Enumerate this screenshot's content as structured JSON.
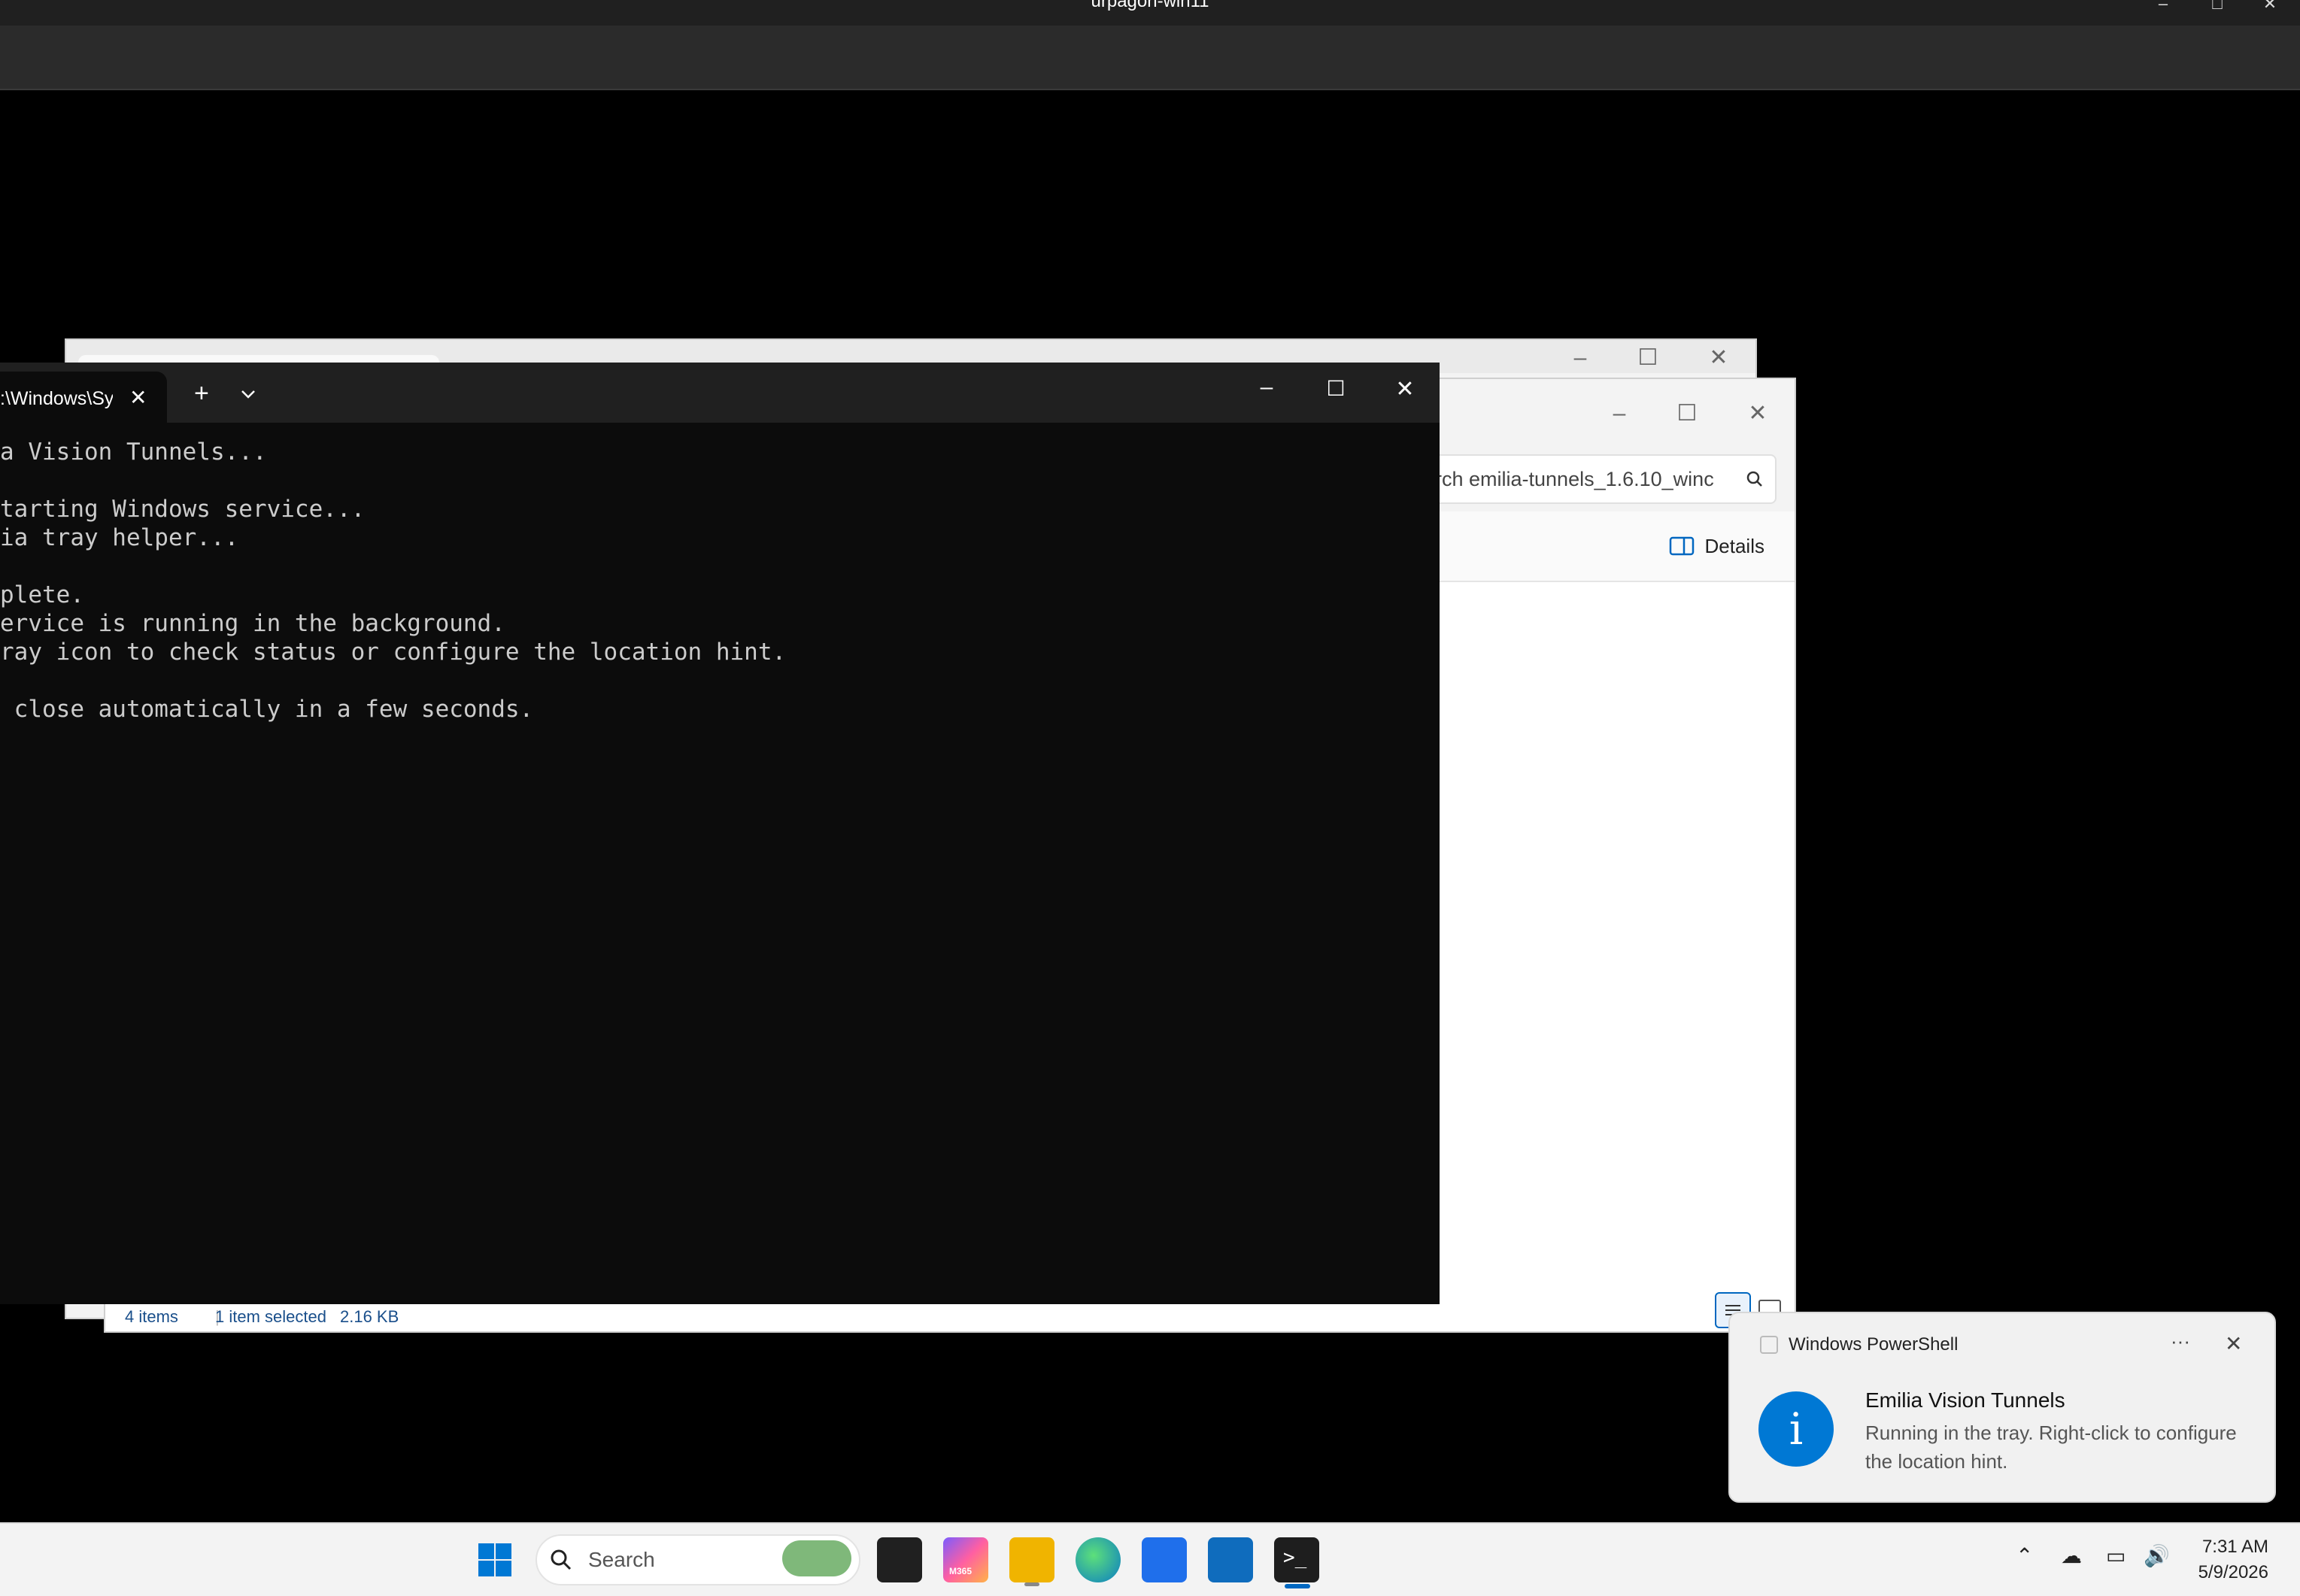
{
  "host_window": {
    "title": "urpagon-win11"
  },
  "explorer": {
    "search_placeholder": "rch emilia-tunnels_1.6.10_winc",
    "details_label": "Details",
    "status": {
      "items": "4 items",
      "selected": "1 item selected",
      "size": "2.16 KB"
    }
  },
  "terminal": {
    "tab_title": ":\\Windows\\Sy",
    "output": "a Vision Tunnels...\n\ntarting Windows service...\nia tray helper...\n\nplete.\nervice is running in the background.\nray icon to check status or configure the location hint.\n\n close automatically in a few seconds."
  },
  "toast": {
    "app_name": "Windows PowerShell",
    "title": "Emilia Vision Tunnels",
    "body": "Running in the tray. Right-click to configure the location hint.",
    "more_glyph": "···"
  },
  "taskbar": {
    "search_label": "Search",
    "copilot_badge": "M365",
    "time": "7:31 AM",
    "date": "5/9/2026"
  },
  "colors": {
    "accent": "#0078d4",
    "terminal_bg": "#0c0c0c",
    "titlebar": "#202020"
  }
}
